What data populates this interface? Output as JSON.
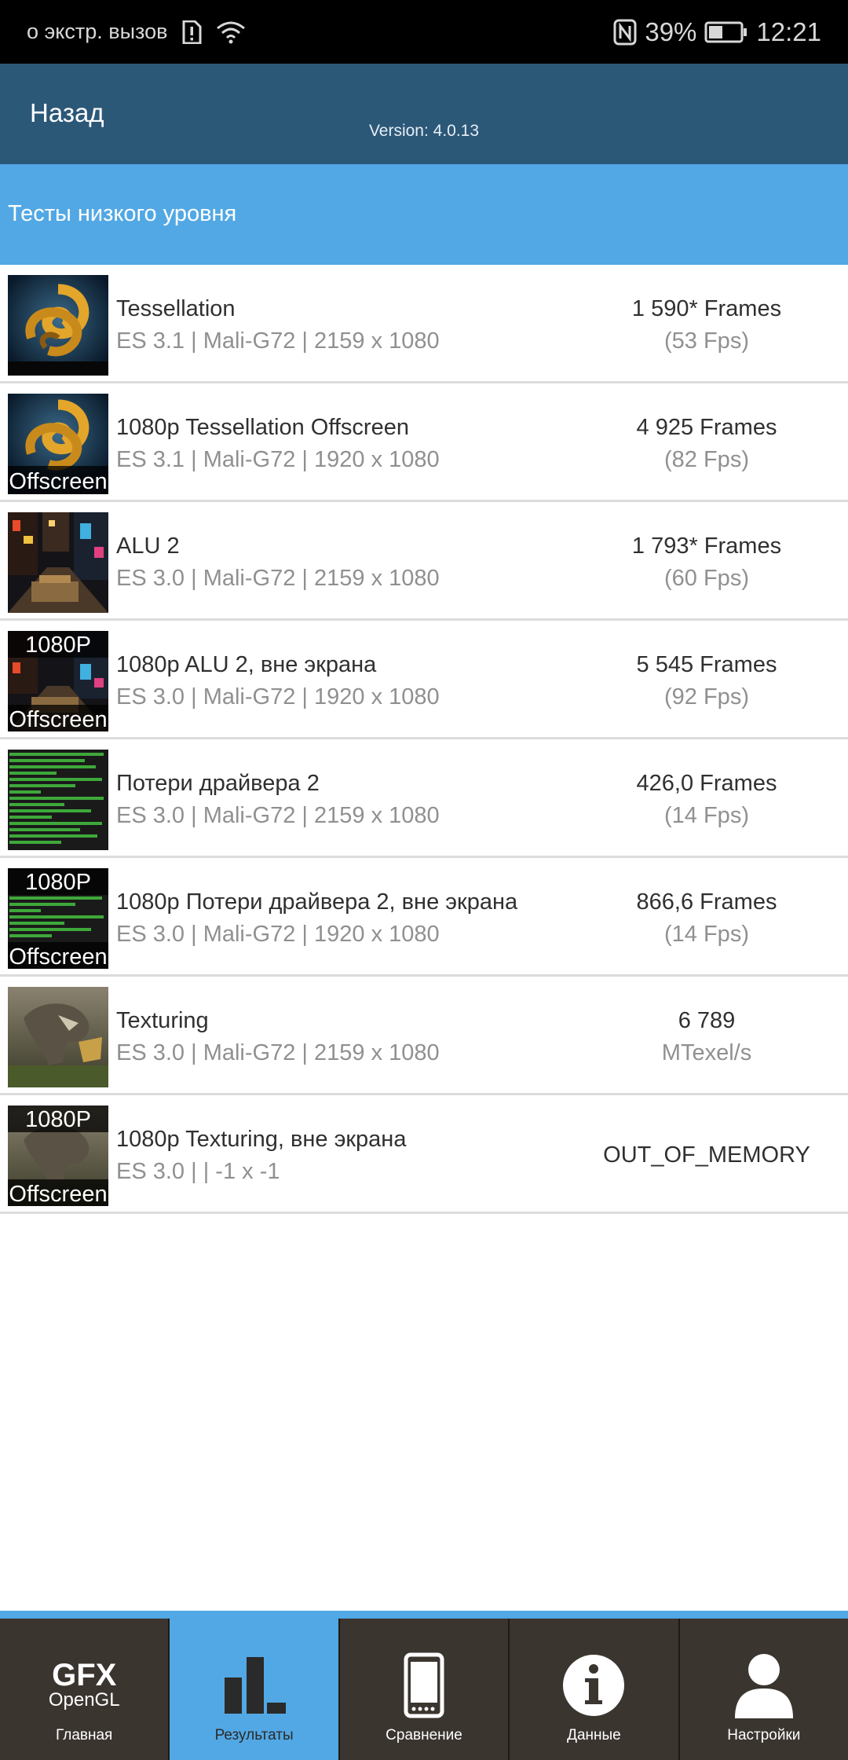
{
  "status_bar": {
    "carrier": "о экстр. вызов",
    "battery": "39%",
    "time": "12:21"
  },
  "header": {
    "back": "Назад",
    "version": "Version: 4.0.13"
  },
  "section": {
    "title": "Тесты низкого уровня"
  },
  "tests": [
    {
      "name": "Tessellation",
      "sub": "ES 3.1 | Mali-G72 | 2159 x 1080",
      "result": "1 590* Frames",
      "detail": "(53 Fps)"
    },
    {
      "name": "1080p Tessellation Offscreen",
      "sub": "ES 3.1 | Mali-G72 | 1920 x 1080",
      "result": "4 925 Frames",
      "detail": "(82 Fps)",
      "badge_bottom": "Offscreen"
    },
    {
      "name": "ALU 2",
      "sub": "ES 3.0 | Mali-G72 | 2159 x 1080",
      "result": "1 793* Frames",
      "detail": "(60 Fps)"
    },
    {
      "name": "1080p ALU 2, вне экрана",
      "sub": "ES 3.0 | Mali-G72 | 1920 x 1080",
      "result": "5 545 Frames",
      "detail": "(92 Fps)",
      "badge_top": "1080P",
      "badge_bottom": "Offscreen"
    },
    {
      "name": "Потери драйвера 2",
      "sub": "ES 3.0 | Mali-G72 | 2159 x 1080",
      "result": "426,0 Frames",
      "detail": "(14 Fps)"
    },
    {
      "name": "1080p Потери драйвера 2, вне экрана",
      "sub": "ES 3.0 | Mali-G72 | 1920 x 1080",
      "result": "866,6 Frames",
      "detail": "(14 Fps)",
      "badge_top": "1080P",
      "badge_bottom": "Offscreen"
    },
    {
      "name": "Texturing",
      "sub": "ES 3.0 | Mali-G72 | 2159 x 1080",
      "result": "6 789",
      "detail": "MTexel/s"
    },
    {
      "name": "1080p Texturing, вне экрана",
      "sub": "ES 3.0 |  | -1 x -1",
      "result": "OUT_OF_MEMORY",
      "badge_top": "1080P",
      "badge_bottom": "Offscreen"
    }
  ],
  "bottom_nav": {
    "logo_top": "GFX",
    "logo_bottom": "OpenGL",
    "items": [
      "Главная",
      "Результаты",
      "Сравнение",
      "Данные",
      "Настройки"
    ]
  }
}
